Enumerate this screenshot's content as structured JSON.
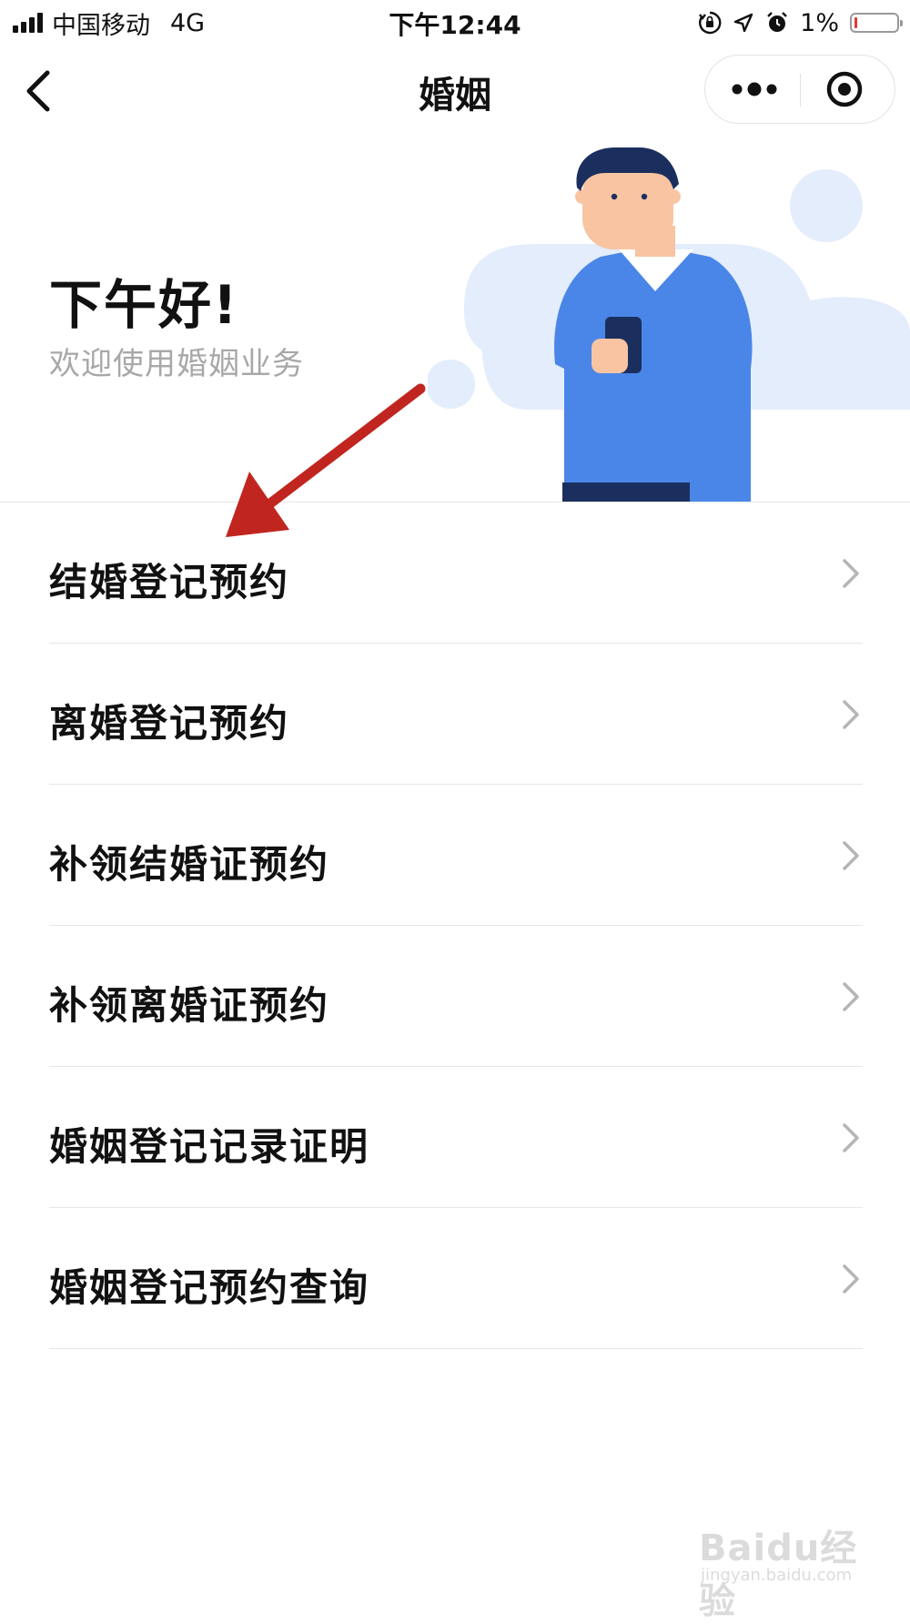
{
  "status_bar": {
    "carrier": "中国移动",
    "network": "4G",
    "time": "下午12:44",
    "battery": "1%",
    "battery_level": 0.01,
    "icons": [
      "signal-icon",
      "orientation-lock-icon",
      "location-icon",
      "alarm-icon",
      "battery-icon"
    ]
  },
  "nav": {
    "title": "婚姻",
    "back_icon": "chevron-left-icon",
    "more_icon": "more-icon",
    "close_icon": "target-icon"
  },
  "hero": {
    "greeting": "下午好!",
    "subtitle": "欢迎使用婚姻业务"
  },
  "menu": {
    "items": [
      {
        "label": "结婚登记预约"
      },
      {
        "label": "离婚登记预约"
      },
      {
        "label": "补领结婚证预约"
      },
      {
        "label": "补领离婚证预约"
      },
      {
        "label": "婚姻登记记录证明"
      },
      {
        "label": "婚姻登记预约查询"
      }
    ],
    "chevron_icon": "chevron-right-icon"
  },
  "watermark": {
    "logo": "Baidu经验",
    "url": "jingyan.baidu.com"
  },
  "colors": {
    "accent_blue": "#4a86e8",
    "navy": "#1b2f5e",
    "light_blue_bg": "#e3edfc",
    "annotation_red": "#c0261f"
  }
}
